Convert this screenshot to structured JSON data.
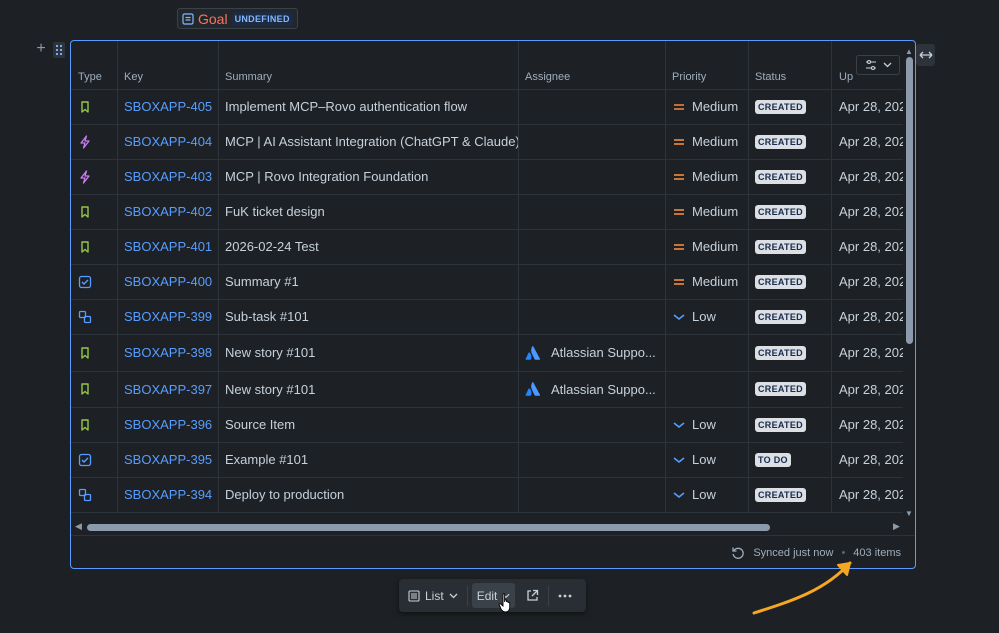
{
  "goal": {
    "label": "Goal",
    "badge": "UNDEFINED"
  },
  "table": {
    "columns": [
      "Type",
      "Key",
      "Summary",
      "Assignee",
      "Priority",
      "Status",
      "Up"
    ],
    "rows": [
      {
        "type": "story",
        "key": "SBOXAPP-405",
        "summary": "Implement MCP–Rovo authentication flow",
        "assignee": "",
        "priority": "Medium",
        "status": "CREATED",
        "updated": "Apr 28, 202"
      },
      {
        "type": "epic",
        "key": "SBOXAPP-404",
        "summary": "MCP | AI Assistant Integration (ChatGPT & Claude)",
        "assignee": "",
        "priority": "Medium",
        "status": "CREATED",
        "updated": "Apr 28, 202"
      },
      {
        "type": "epic",
        "key": "SBOXAPP-403",
        "summary": "MCP | Rovo Integration Foundation",
        "assignee": "",
        "priority": "Medium",
        "status": "CREATED",
        "updated": "Apr 28, 202"
      },
      {
        "type": "story",
        "key": "SBOXAPP-402",
        "summary": "FuK ticket design",
        "assignee": "",
        "priority": "Medium",
        "status": "CREATED",
        "updated": "Apr 28, 202"
      },
      {
        "type": "story",
        "key": "SBOXAPP-401",
        "summary": "2026-02-24 Test",
        "assignee": "",
        "priority": "Medium",
        "status": "CREATED",
        "updated": "Apr 28, 202"
      },
      {
        "type": "task",
        "key": "SBOXAPP-400",
        "summary": "Summary #1",
        "assignee": "",
        "priority": "Medium",
        "status": "CREATED",
        "updated": "Apr 28, 202"
      },
      {
        "type": "subtask",
        "key": "SBOXAPP-399",
        "summary": "Sub-task #101",
        "assignee": "",
        "priority": "Low",
        "status": "CREATED",
        "updated": "Apr 28, 202"
      },
      {
        "type": "story",
        "key": "SBOXAPP-398",
        "summary": "New story #101",
        "assignee": "Atlassian Suppo...",
        "priority": "",
        "status": "CREATED",
        "updated": "Apr 28, 202"
      },
      {
        "type": "story",
        "key": "SBOXAPP-397",
        "summary": "New story #101",
        "assignee": "Atlassian Suppo...",
        "priority": "",
        "status": "CREATED",
        "updated": "Apr 28, 202"
      },
      {
        "type": "story",
        "key": "SBOXAPP-396",
        "summary": "Source Item",
        "assignee": "",
        "priority": "Low",
        "status": "CREATED",
        "updated": "Apr 28, 202"
      },
      {
        "type": "task",
        "key": "SBOXAPP-395",
        "summary": "Example #101",
        "assignee": "",
        "priority": "Low",
        "status": "TO DO",
        "updated": "Apr 28, 202"
      },
      {
        "type": "subtask",
        "key": "SBOXAPP-394",
        "summary": "Deploy to production",
        "assignee": "",
        "priority": "Low",
        "status": "CREATED",
        "updated": "Apr 28, 202"
      }
    ]
  },
  "footer": {
    "sync_text": "Synced just now",
    "separator": "•",
    "item_count": "403 items"
  },
  "toolbar": {
    "list_label": "List",
    "edit_label": "Edit"
  },
  "colors": {
    "story": "#94c748",
    "epic": "#c97cf4",
    "task": "#579dff",
    "subtask": "#579dff",
    "medium": "#f38a3f",
    "low": "#579dff",
    "accent": "#579dff",
    "annotation": "#f5a623"
  }
}
